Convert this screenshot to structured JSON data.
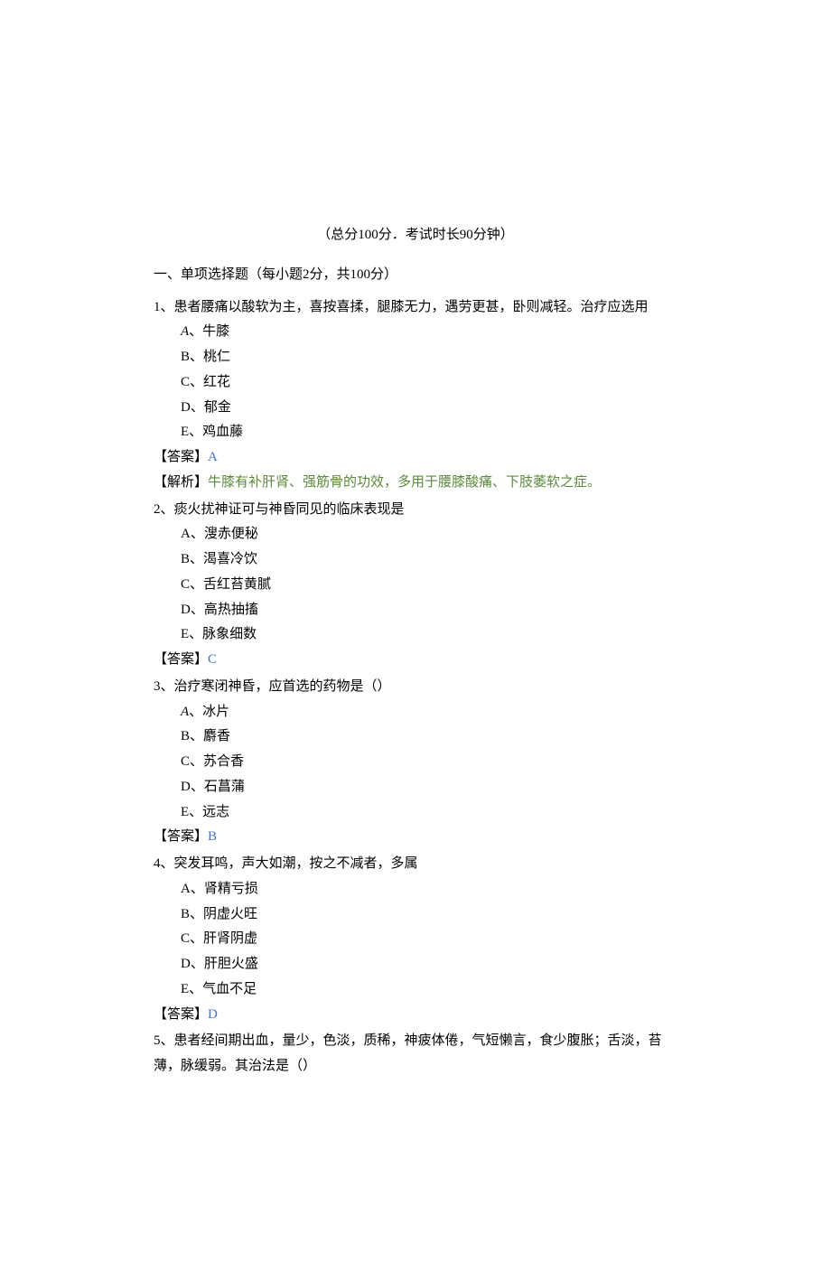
{
  "meta_line": "（总分100分．考试时长90分钟）",
  "section_heading": "一、单项选择题（每小题2分，共100分）",
  "answer_label": "【答案】",
  "explanation_label": "【解析】",
  "questions": [
    {
      "num": "1、",
      "text": "患者腰痛以酸软为主，喜按喜揉，腿膝无力，遇劳更甚，卧则减轻。治疗应选用",
      "options": [
        {
          "letter_italic": "A",
          "rest": "、牛膝"
        },
        {
          "label": "B、桃仁"
        },
        {
          "label": "C、红花"
        },
        {
          "label": "D、郁金"
        },
        {
          "label": "E、鸡血藤"
        }
      ],
      "answer": "A",
      "explanation": "牛膝有补肝肾、强筋骨的功效，多用于腰膝酸痛、下肢萎软之症。"
    },
    {
      "num": "2、",
      "text": "痰火扰神证可与神昏同见的临床表现是",
      "options": [
        {
          "label": "A、溲赤便秘"
        },
        {
          "label": "B、渴喜冷饮"
        },
        {
          "label": "C、舌红苔黄腻"
        },
        {
          "label": "D、高热抽搐"
        },
        {
          "label": "E、脉象细数"
        }
      ],
      "answer": "C"
    },
    {
      "num": "3、",
      "text": "治疗寒闭神昏，应首选的药物是（）",
      "options": [
        {
          "letter_italic": "A",
          "rest": "、冰片"
        },
        {
          "label": "B、麝香"
        },
        {
          "label": "C、苏合香"
        },
        {
          "label": "D、石菖蒲"
        },
        {
          "label": "E、远志"
        }
      ],
      "answer": "B"
    },
    {
      "num": "4、",
      "text": "突发耳鸣，声大如潮，按之不减者，多属",
      "options": [
        {
          "label": "A、肾精亏损"
        },
        {
          "label": "B、阴虚火旺"
        },
        {
          "label": "C、肝肾阴虚"
        },
        {
          "label": "D、肝胆火盛"
        },
        {
          "label": "E、气血不足"
        }
      ],
      "answer": "D"
    },
    {
      "num": "5、",
      "text": "患者经间期出血，量少，色淡，质稀，神疲体倦，气短懒言，食少腹胀；舌淡，苔薄，脉缓弱。其治法是（）",
      "options": []
    }
  ]
}
